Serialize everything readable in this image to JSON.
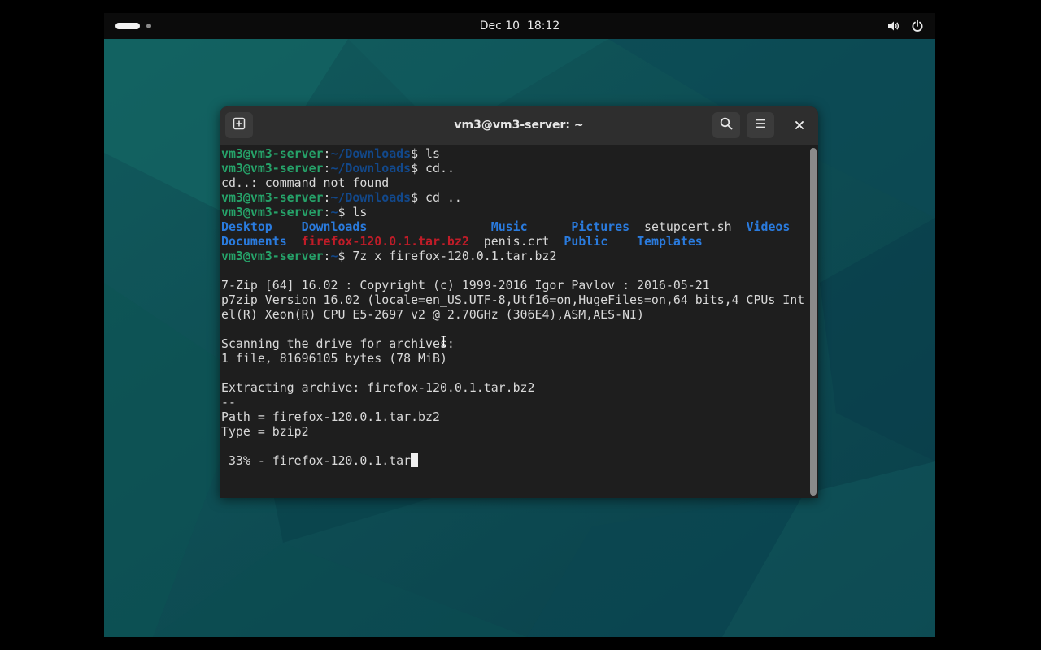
{
  "topbar": {
    "date": "Dec 10",
    "time": "18:12",
    "activities_icon": "activities-pill-icon",
    "volume_icon": "volume-icon",
    "power_icon": "power-icon"
  },
  "terminal": {
    "title": "vm3@vm3-server: ~",
    "new_tab_icon": "new-tab-icon",
    "search_icon": "search-icon",
    "menu_icon": "hamburger-menu-icon",
    "close_icon": "close-icon",
    "prompt_user": "vm3@vm3-server",
    "prompt_sep": ":",
    "dl_path": "~/Downloads",
    "home_path": "~",
    "dollar": "$ ",
    "cmd_ls1": "ls",
    "cmd_cd_bad": "cd..",
    "err_line": "cd..: command not found",
    "cmd_cd": "cd ..",
    "cmd_ls2": "ls",
    "ls_row1": {
      "desktop": "Desktop",
      "gap1": "    ",
      "downloads": "Downloads",
      "gap2": "                 ",
      "music": "Music",
      "gap3": "      ",
      "pictures": "Pictures",
      "gap4": "  ",
      "setupcert": "setupcert.sh",
      "gap5": "  ",
      "videos": "Videos"
    },
    "ls_row2": {
      "documents": "Documents",
      "gap1": "  ",
      "firefox": "firefox-120.0.1.tar.bz2",
      "gap2": "  ",
      "penis": "penis.crt",
      "gap3": "  ",
      "public": "Public",
      "gap4": "    ",
      "templates": "Templates"
    },
    "cmd_7z": "7z x firefox-120.0.1.tar.bz2",
    "out_1": "7-Zip [64] 16.02 : Copyright (c) 1999-2016 Igor Pavlov : 2016-05-21",
    "out_2": "p7zip Version 16.02 (locale=en_US.UTF-8,Utf16=on,HugeFiles=on,64 bits,4 CPUs Int",
    "out_3": "el(R) Xeon(R) CPU E5-2697 v2 @ 2.70GHz (306E4),ASM,AES-NI)",
    "out_4": "Scanning the drive for archives:",
    "out_5": "1 file, 81696105 bytes (78 MiB)",
    "out_6": "Extracting archive: firefox-120.0.1.tar.bz2",
    "out_7": "--",
    "out_8": "Path = firefox-120.0.1.tar.bz2",
    "out_9": "Type = bzip2",
    "progress_text": " 33% - firefox-120.0.1.tar",
    "progress_fraction": 0.33
  },
  "colors": {
    "prompt_user": "#26a269",
    "prompt_path": "#12488b",
    "directory": "#2a7bde",
    "archive": "#c01c28",
    "terminal_bg": "#1e1e1e",
    "desktop_bg": "#0f4f57"
  }
}
